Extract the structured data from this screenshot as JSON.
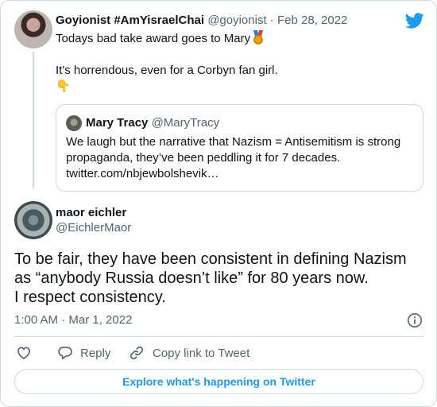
{
  "brand": {
    "icon": "twitter-bird-icon",
    "color": "#1d9bf0"
  },
  "parent_tweet": {
    "display_name": "Goyionist #AmYisraelChai",
    "handle": "@goyionist",
    "separator": "·",
    "date": "Feb 28, 2022",
    "text_line_1": "Todays bad take award goes to Mary",
    "text_line_1_emoji": "medal-icon",
    "text_line_2": "It's horrendous, even for a Corbyn fan girl.",
    "text_line_3": "👇"
  },
  "quoted_tweet": {
    "display_name": "Mary Tracy",
    "handle": "@MaryTracy",
    "line_1": "We laugh but the narrative that Nazism = Antisemitism is strong",
    "line_2": "propaganda, they’ve been peddling it for 7 decades.",
    "line_3": "twitter.com/nbjewbolshevik…"
  },
  "main_tweet": {
    "display_name": "maor eichler",
    "handle": "@EichlerMaor",
    "line_1": "To be fair, they have been consistent in defining Nazism",
    "line_2": "as “anybody Russia doesn’t like” for 80 years now.",
    "line_3": "I respect consistency.",
    "timestamp": "1:00 AM · Mar 1, 2022"
  },
  "actions": {
    "like_icon": "heart-icon",
    "reply_label": "Reply",
    "reply_icon": "reply-bubble-icon",
    "copy_label": "Copy link to Tweet",
    "copy_icon": "link-icon"
  },
  "footer": {
    "explore_label": "Explore what's happening on Twitter"
  }
}
